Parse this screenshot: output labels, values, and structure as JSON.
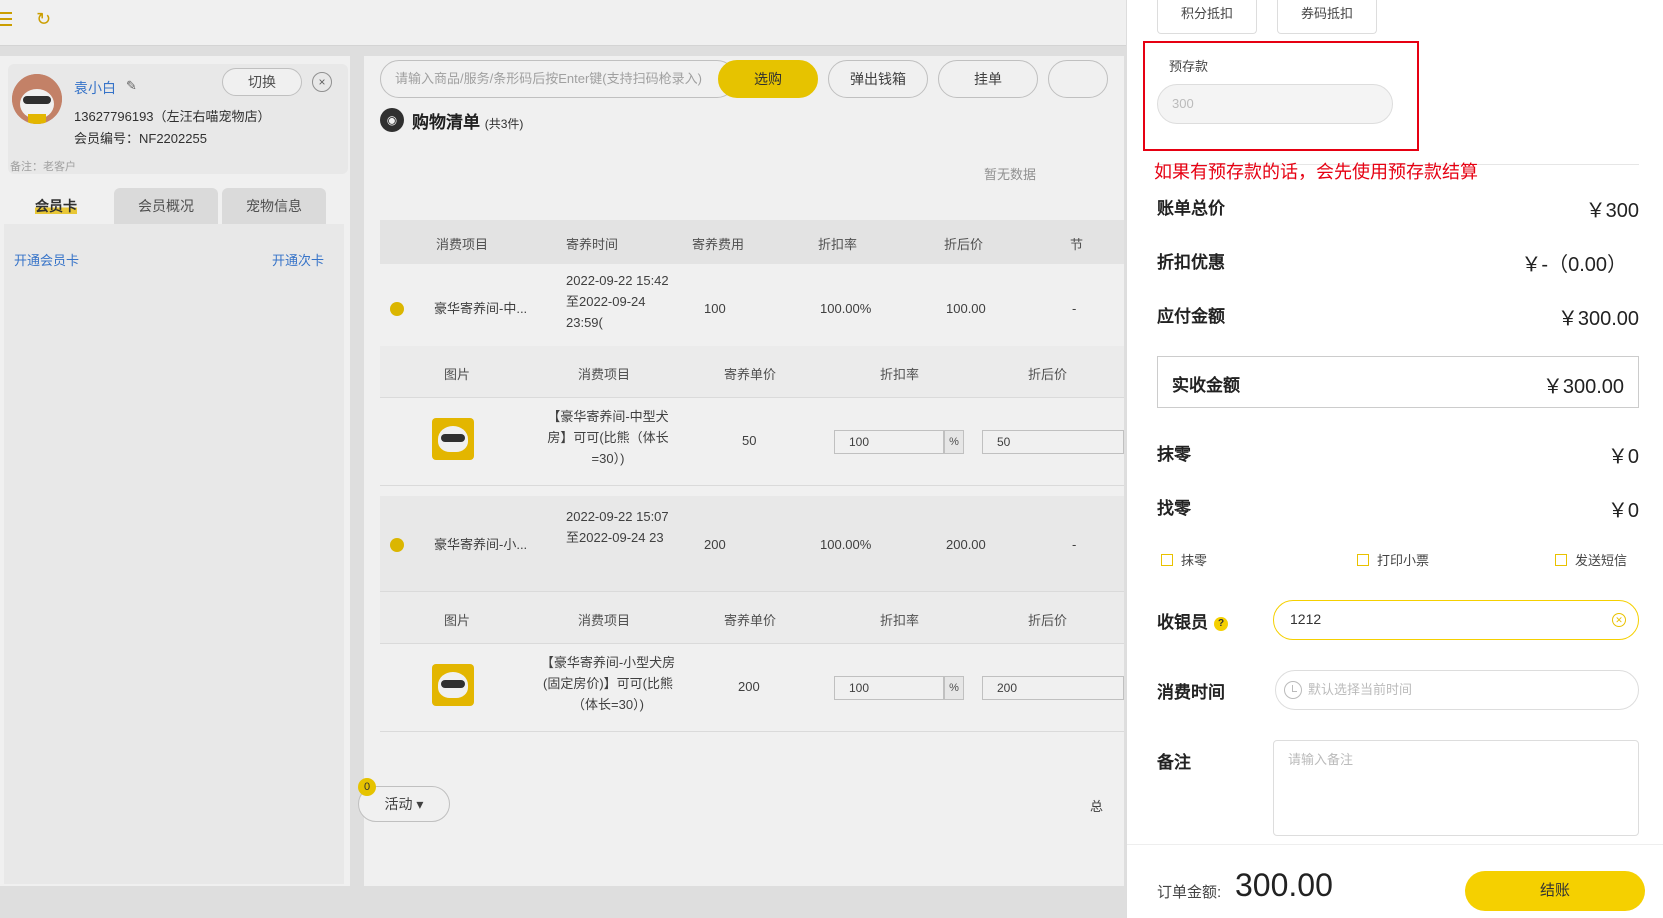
{
  "topbar": {
    "menu_icon": "menu-icon",
    "refresh_icon": "refresh-icon"
  },
  "member": {
    "name": "袁小白",
    "switch_label": "切换",
    "close_label": "×",
    "phone": "13627796193（左汪右喵宠物店）",
    "member_no": "会员编号：NF2202255",
    "remark": "备注：老客户"
  },
  "tabs": [
    "会员卡",
    "会员概况",
    "宠物信息"
  ],
  "member_links": {
    "open_card": "开通会员卡",
    "open_times": "开通次卡"
  },
  "toolbar": {
    "search_placeholder": "请输入商品/服务/条形码后按Enter键(支持扫码枪录入)",
    "select_label": "选购",
    "cashbox_label": "弹出钱箱",
    "hold_label": "挂单"
  },
  "cart": {
    "title": "购物清单",
    "count": "(共3件)",
    "nodata": "暂无数据",
    "headers": [
      "消费项目",
      "寄养时间",
      "寄养费用",
      "折扣率",
      "折后价",
      "节"
    ],
    "sub_headers": [
      "图片",
      "消费项目",
      "寄养单价",
      "折扣率",
      "折后价"
    ],
    "rows": [
      {
        "item": "豪华寄养间-中...",
        "time": "2022-09-22 15:42至2022-09-24 23:59(",
        "fee": "100",
        "rate": "100.00%",
        "price": "100.00",
        "dash": "-",
        "sub": {
          "name": "【豪华寄养间-中型犬房】可可(比熊（体长=30）)",
          "unit": "50",
          "rate": "100",
          "pct": "%",
          "price": "50"
        }
      },
      {
        "item": "豪华寄养间-小...",
        "time": "2022-09-22 15:07至2022-09-24 23",
        "fee": "200",
        "rate": "100.00%",
        "price": "200.00",
        "dash": "-",
        "sub": {
          "name": "【豪华寄养间-小型犬房(固定房价)】可可(比熊（体长=30）)",
          "unit": "200",
          "rate": "100",
          "pct": "%",
          "price": "200"
        }
      }
    ]
  },
  "bottom": {
    "badge": "0",
    "activity_label": "活动 ▾",
    "total_cut": "总"
  },
  "drawer": {
    "tabs": {
      "points": "积分抵扣",
      "coupon": "券码抵扣"
    },
    "deposit_label": "预存款",
    "deposit_value": "300",
    "annotation": "如果有预存款的话，会先使用预存款结算",
    "bill_total_label": "账单总价",
    "bill_total": "￥300",
    "discount_label": "折扣优惠",
    "discount": "￥-（0.00）",
    "payable_label": "应付金额",
    "payable": "￥300.00",
    "received_label": "实收金额",
    "received": "￥300.00",
    "round_label": "抹零",
    "round": "￥0",
    "change_label": "找零",
    "change": "￥0",
    "checkboxes": [
      "抹零",
      "打印小票",
      "发送短信"
    ],
    "cashier_label": "收银员",
    "cashier_value": "1212",
    "time_label": "消费时间",
    "time_placeholder": "默认选择当前时间",
    "remark_label": "备注",
    "remark_placeholder": "请输入备注",
    "order_label": "订单金额:",
    "order_amount": "300.00",
    "pay_label": "结账"
  },
  "colors": {
    "accent": "#f5d000",
    "link": "#3a7bd5",
    "annotation": "#e60012"
  }
}
